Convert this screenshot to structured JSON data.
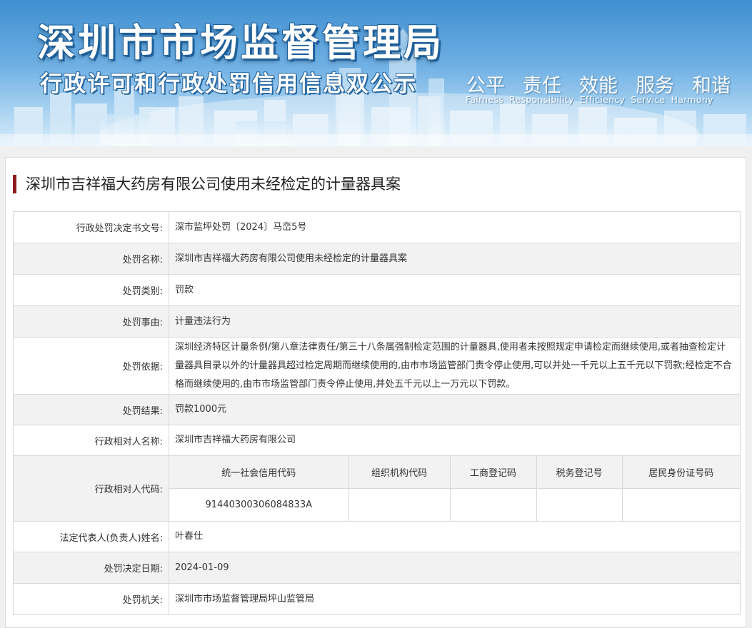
{
  "banner": {
    "title": "深圳市市场监督管理局",
    "subtitle": "行政许可和行政处罚信用信息双公示",
    "slogan_cn": [
      "公平",
      "责任",
      "效能",
      "服务",
      "和谐"
    ],
    "slogan_en": [
      "Fairness",
      "Responsibility",
      "Efficiency",
      "Service",
      "Harmony"
    ]
  },
  "case_title": "深圳市吉祥福大药房有限公司使用未经检定的计量器具案",
  "fields": {
    "doc_no": {
      "label": "行政处罚决定书文号:",
      "value": "深市监坪处罚〔2024〕马峦5号"
    },
    "name": {
      "label": "处罚名称:",
      "value": "深圳市吉祥福大药房有限公司使用未经检定的计量器具案"
    },
    "category": {
      "label": "处罚类别:",
      "value": "罚款"
    },
    "reason": {
      "label": "处罚事由:",
      "value": "计量违法行为"
    },
    "basis": {
      "label": "处罚依据:",
      "value": "深圳经济特区计量条例/第八章法律责任/第三十八条属强制检定范围的计量器具,使用者未按照规定申请检定而继续使用,或者抽查检定计量器具目录以外的计量器具超过检定周期而继续使用的,由市市场监管部门责令停止使用,可以并处一千元以上五千元以下罚款;经检定不合格而继续使用的,由市市场监管部门责令停止使用,并处五千元以上一万元以下罚款。"
    },
    "result": {
      "label": "处罚结果:",
      "value": "罚款1000元"
    },
    "party_name": {
      "label": "行政相对人名称:",
      "value": "深圳市吉祥福大药房有限公司"
    },
    "party_code": {
      "label": "行政相对人代码:",
      "headers": [
        "统一社会信用代码",
        "组织机构代码",
        "工商登记码",
        "税务登记号",
        "居民身份证号码"
      ],
      "values": [
        "91440300306084833A",
        "",
        "",
        "",
        ""
      ]
    },
    "legal_rep": {
      "label": "法定代表人(负责人)姓名:",
      "value": "叶春仕"
    },
    "date": {
      "label": "处罚决定日期:",
      "value": "2024-01-09"
    },
    "authority": {
      "label": "处罚机关:",
      "value": "深圳市市场监督管理局坪山监管局"
    }
  }
}
